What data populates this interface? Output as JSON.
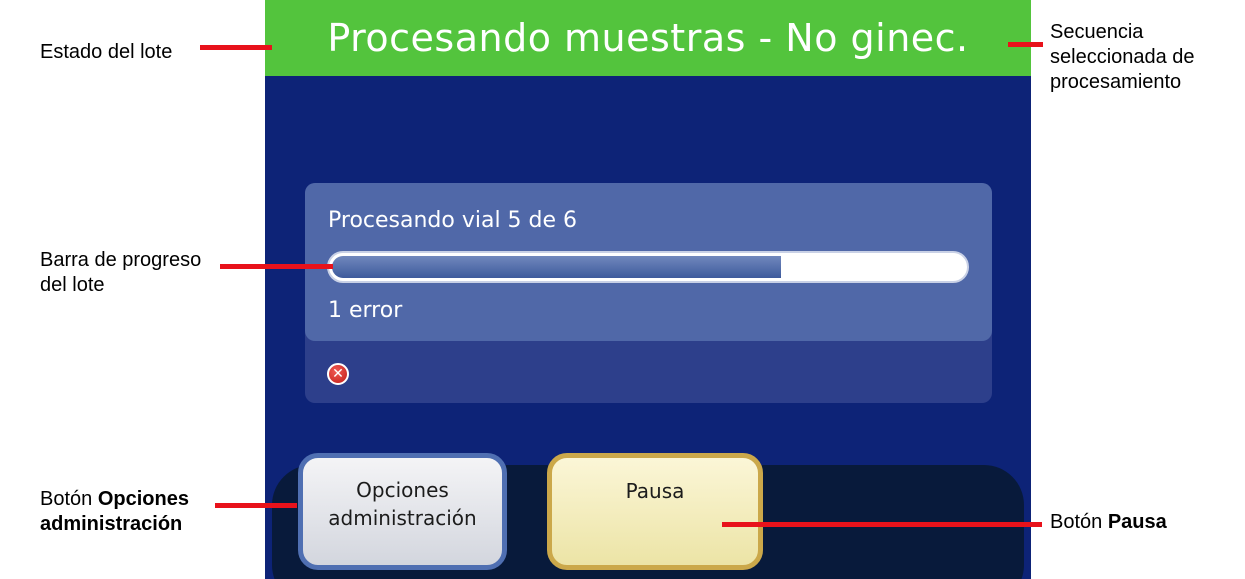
{
  "screen": {
    "status_title": "Procesando muestras - No ginec.",
    "status_color": "#53c43d",
    "progress": {
      "text": "Procesando vial 5 de 6",
      "fraction": 0.71,
      "error_text": "1 error"
    },
    "error_icon": "error-x-icon",
    "buttons": {
      "admin_label_line1": "Opciones",
      "admin_label_line2": "administración",
      "pause_label": "Pausa"
    }
  },
  "callouts": {
    "batch_status": "Estado del lote",
    "sequence_line1": "Secuencia",
    "sequence_line2": "seleccionada de",
    "sequence_line3": "procesamiento",
    "progress_bar_line1": "Barra de progreso",
    "progress_bar_line2": "del lote",
    "admin_prefix": "Botón",
    "admin_bold_line1": "Opciones",
    "admin_bold_line2": "administración",
    "pause_prefix": "Botón",
    "pause_bold": "Pausa"
  }
}
